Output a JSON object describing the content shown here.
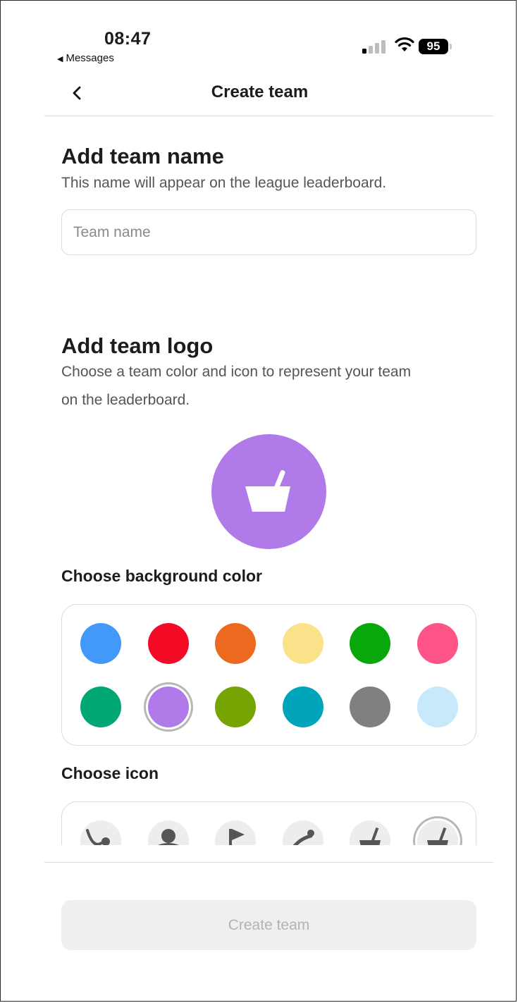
{
  "status_bar": {
    "time": "08:47",
    "back_app": "Messages",
    "battery": "95"
  },
  "nav": {
    "title": "Create team"
  },
  "team_name": {
    "heading": "Add team name",
    "subtitle": "This name will appear on the league leaderboard.",
    "input_placeholder": "Team name",
    "input_value": ""
  },
  "team_logo": {
    "heading": "Add team logo",
    "subtitle_line1": "Choose a team color and icon to represent your team",
    "subtitle_line2": "on the leaderboard.",
    "preview_color": "#b07be9",
    "preview_icon": "mortar-pestle-icon"
  },
  "background_color": {
    "label": "Choose background color",
    "selected": "#b07be9",
    "colors": [
      "#4399fa",
      "#f30a25",
      "#ec6a1f",
      "#fce18b",
      "#08a80c",
      "#fe5487",
      "#00a775",
      "#b07be9",
      "#76a402",
      "#00a5bb",
      "#808080",
      "#c8e9f9"
    ]
  },
  "icon": {
    "label": "Choose icon",
    "options": [
      "swing-icon",
      "bowling-ball-icon",
      "flag-icon",
      "hammer-throw-icon",
      "mortar-icon",
      "mortar-pestle-icon"
    ],
    "selected": "mortar-pestle-icon"
  },
  "footer": {
    "cta_label": "Create team"
  }
}
